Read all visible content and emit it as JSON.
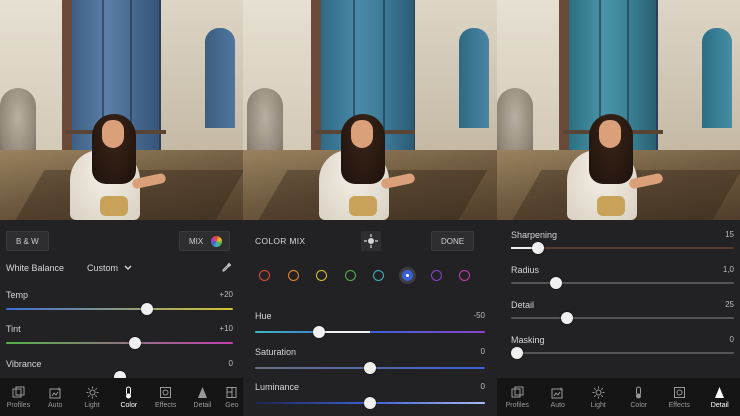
{
  "left_panel": {
    "bw_label": "B & W",
    "mix_label": "MIX",
    "white_balance_label": "White Balance",
    "white_balance_value": "Custom",
    "sliders": [
      {
        "label": "Temp",
        "value": "+20",
        "position": 0.62
      },
      {
        "label": "Tint",
        "value": "+10",
        "position": 0.57
      },
      {
        "label": "Vibrance",
        "value": "0",
        "position": 0.5
      }
    ],
    "tabs": [
      {
        "label": "Profiles",
        "icon": "profiles-icon"
      },
      {
        "label": "Auto",
        "icon": "auto-icon"
      },
      {
        "label": "Light",
        "icon": "light-icon"
      },
      {
        "label": "Color",
        "icon": "color-icon",
        "active": true
      },
      {
        "label": "Effects",
        "icon": "effects-icon"
      },
      {
        "label": "Detail",
        "icon": "detail-icon"
      },
      {
        "label": "Geo",
        "icon": "geometry-icon"
      }
    ]
  },
  "middle_panel": {
    "title": "COLOR MIX",
    "done_label": "DONE",
    "swatches": [
      {
        "color": "#e04a3b"
      },
      {
        "color": "#e58a2e"
      },
      {
        "color": "#d6c431"
      },
      {
        "color": "#53b04a"
      },
      {
        "color": "#3fb6c0"
      },
      {
        "color": "#3b5fd6",
        "selected": true
      },
      {
        "color": "#8a45c9"
      },
      {
        "color": "#c43fb0"
      }
    ],
    "sliders": [
      {
        "label": "Hue",
        "value": "-50",
        "position": 0.28
      },
      {
        "label": "Saturation",
        "value": "0",
        "position": 0.5
      },
      {
        "label": "Luminance",
        "value": "0",
        "position": 0.5
      }
    ]
  },
  "right_panel": {
    "sliders": [
      {
        "label": "Sharpening",
        "value": "15",
        "position": 0.12
      },
      {
        "label": "Radius",
        "value": "1,0",
        "position": 0.2
      },
      {
        "label": "Detail",
        "value": "25",
        "position": 0.25
      },
      {
        "label": "Masking",
        "value": "0",
        "position": 0.0
      }
    ],
    "tabs": [
      {
        "label": "Profiles",
        "icon": "profiles-icon"
      },
      {
        "label": "Auto",
        "icon": "auto-icon"
      },
      {
        "label": "Light",
        "icon": "light-icon"
      },
      {
        "label": "Color",
        "icon": "color-icon"
      },
      {
        "label": "Effects",
        "icon": "effects-icon"
      },
      {
        "label": "Detail",
        "icon": "detail-icon",
        "active": true
      }
    ]
  },
  "colors": {
    "accent_white": "#f0f0f0",
    "panel_bg": "#222224",
    "tabbar_bg": "#151515"
  }
}
